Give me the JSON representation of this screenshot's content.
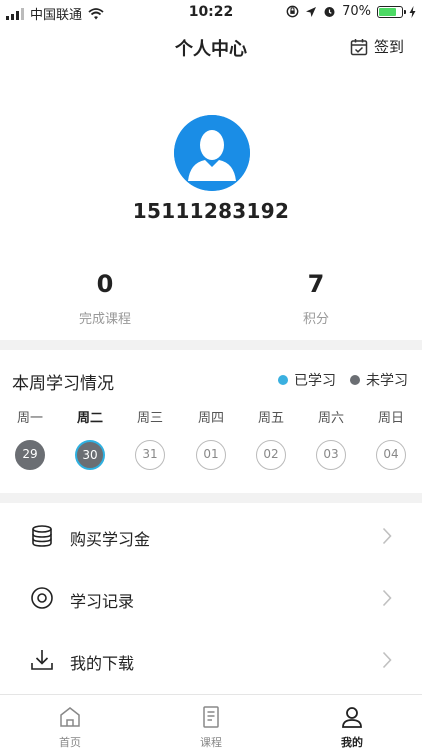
{
  "status_bar": {
    "carrier": "中国联通",
    "time": "10:22",
    "battery_text": "70%",
    "battery_level": 0.7
  },
  "header": {
    "title": "个人中心",
    "checkin_label": "签到"
  },
  "profile": {
    "phone": "15111283192"
  },
  "stats": [
    {
      "value": "0",
      "label": "完成课程"
    },
    {
      "value": "7",
      "label": "积分"
    }
  ],
  "weekly": {
    "title": "本周学习情况",
    "legend": [
      {
        "label": "已学习",
        "color": "#3ab0e0"
      },
      {
        "label": "未学习",
        "color": "#6b6e73"
      }
    ],
    "days": [
      {
        "name": "周一",
        "date": "29",
        "state": "past"
      },
      {
        "name": "周二",
        "date": "30",
        "state": "today"
      },
      {
        "name": "周三",
        "date": "31",
        "state": "future"
      },
      {
        "name": "周四",
        "date": "01",
        "state": "future"
      },
      {
        "name": "周五",
        "date": "02",
        "state": "future"
      },
      {
        "name": "周六",
        "date": "03",
        "state": "future"
      },
      {
        "name": "周日",
        "date": "04",
        "state": "future"
      }
    ]
  },
  "menu": [
    {
      "label": "购买学习金",
      "icon": "database-icon"
    },
    {
      "label": "学习记录",
      "icon": "eye-icon"
    },
    {
      "label": "我的下载",
      "icon": "download-icon"
    }
  ],
  "tabs": [
    {
      "label": "首页",
      "icon": "home-icon"
    },
    {
      "label": "课程",
      "icon": "document-icon"
    },
    {
      "label": "我的",
      "icon": "user-icon",
      "active": true
    }
  ]
}
